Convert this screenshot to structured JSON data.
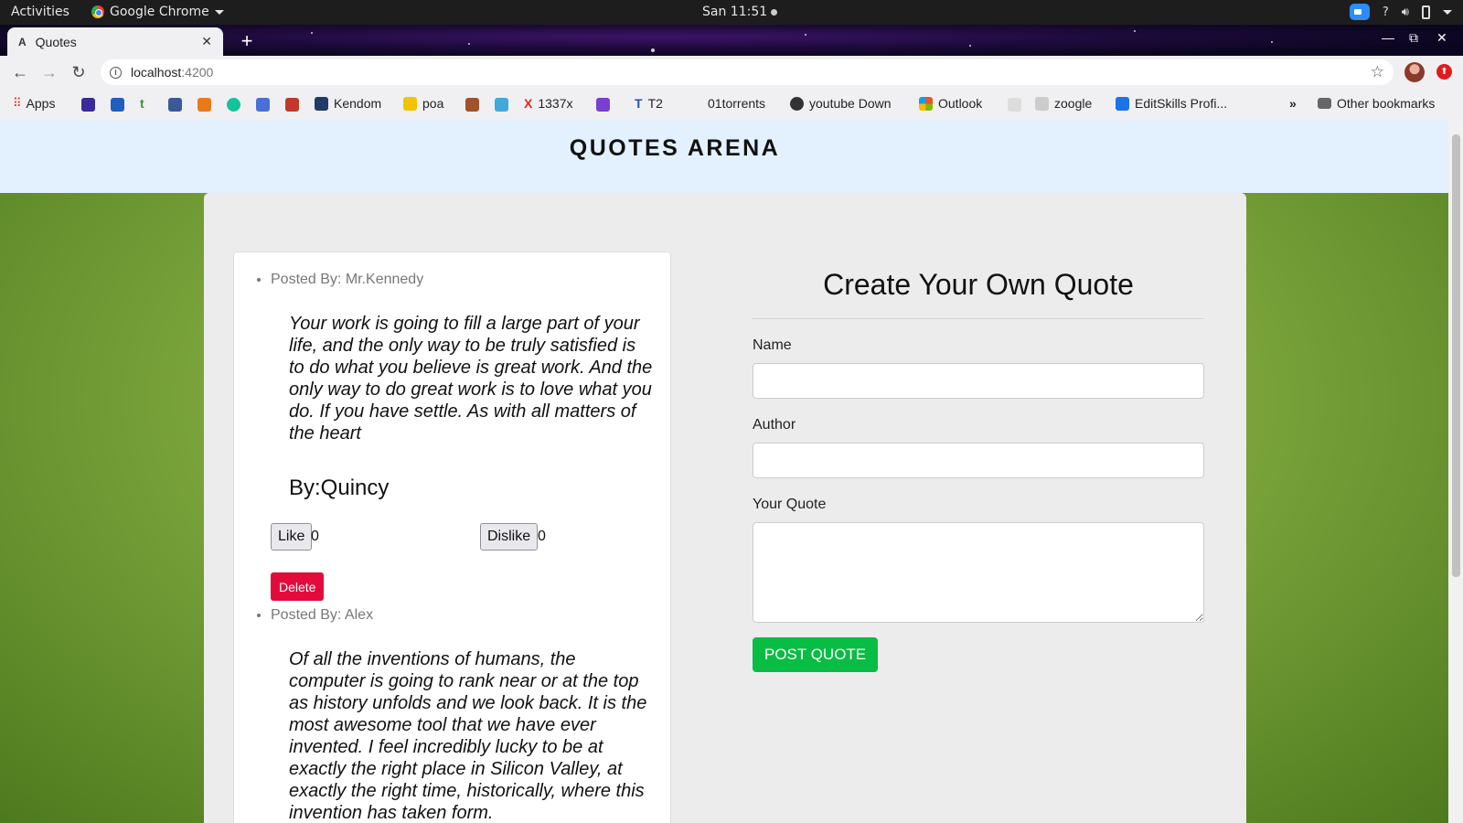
{
  "system_bar": {
    "activities": "Activities",
    "app_name": "Google Chrome",
    "clock": "San 11:51",
    "tray_help": "?"
  },
  "browser": {
    "tab_title": "Quotes",
    "url_host": "localhost",
    "url_port": ":4200",
    "bookmarks": {
      "apps": "Apps",
      "kendom": "Kendom",
      "poa": "poa",
      "torrent": "1337x",
      "t2": "T2",
      "o1torrents": "01torrents",
      "youtube": "youtube Down",
      "outlook": "Outlook",
      "zoogle": "zoogle",
      "editskills": "EditSkills Profi...",
      "overflow": "»",
      "other": "Other bookmarks"
    }
  },
  "page": {
    "site_title": "QUOTES ARENA",
    "quotes": [
      {
        "posted_by": "Posted By: Mr.Kennedy",
        "text": "Your work is going to fill a large part of your life, and the only way to be truly satisfied is to do what you believe is great work. And the only way to do great work is to love what you do. If you have settle. As with all matters of the heart",
        "author": "By:Quincy",
        "like_label": "Like",
        "likes": "0",
        "dislike_label": "Dislike",
        "dislikes": "0",
        "delete_label": "Delete"
      },
      {
        "posted_by": "Posted By: Alex",
        "text": "Of all the inventions of humans, the computer is going to rank near or at the top as history unfolds and we look back. It is the most awesome tool that we have ever invented. I feel incredibly lucky to be at exactly the right place in Silicon Valley, at exactly the right time, historically, where this invention has taken form."
      }
    ],
    "form": {
      "heading": "Create Your Own Quote",
      "name_label": "Name",
      "name_value": "",
      "author_label": "Author",
      "author_value": "",
      "quote_label": "Your Quote",
      "quote_value": "",
      "submit_label": "POST QUOTE"
    }
  },
  "colors": {
    "header_bg": "#e3f1ff",
    "delete_button": "#e30b3c",
    "post_button": "#08bd43",
    "page_background": "#7fa83e"
  }
}
